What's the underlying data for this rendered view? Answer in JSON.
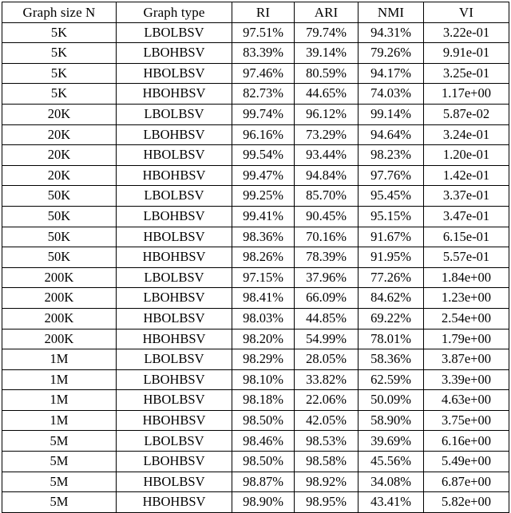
{
  "table": {
    "columns": [
      "Graph size N",
      "Graph type",
      "RI",
      "ARI",
      "NMI",
      "VI"
    ],
    "rows": [
      [
        "5K",
        "LBOLBSV",
        "97.51%",
        "79.74%",
        "94.31%",
        "3.22e-01"
      ],
      [
        "5K",
        "LBOHBSV",
        "83.39%",
        "39.14%",
        "79.26%",
        "9.91e-01"
      ],
      [
        "5K",
        "HBOLBSV",
        "97.46%",
        "80.59%",
        "94.17%",
        "3.25e-01"
      ],
      [
        "5K",
        "HBOHBSV",
        "82.73%",
        "44.65%",
        "74.03%",
        "1.17e+00"
      ],
      [
        "20K",
        "LBOLBSV",
        "99.74%",
        "96.12%",
        "99.14%",
        "5.87e-02"
      ],
      [
        "20K",
        "LBOHBSV",
        "96.16%",
        "73.29%",
        "94.64%",
        "3.24e-01"
      ],
      [
        "20K",
        "HBOLBSV",
        "99.54%",
        "93.44%",
        "98.23%",
        "1.20e-01"
      ],
      [
        "20K",
        "HBOHBSV",
        "99.47%",
        "94.84%",
        "97.76%",
        "1.42e-01"
      ],
      [
        "50K",
        "LBOLBSV",
        "99.25%",
        "85.70%",
        "95.45%",
        "3.37e-01"
      ],
      [
        "50K",
        "LBOHBSV",
        "99.41%",
        "90.45%",
        "95.15%",
        "3.47e-01"
      ],
      [
        "50K",
        "HBOLBSV",
        "98.36%",
        "70.16%",
        "91.67%",
        "6.15e-01"
      ],
      [
        "50K",
        "HBOHBSV",
        "98.26%",
        "78.39%",
        "91.95%",
        "5.57e-01"
      ],
      [
        "200K",
        "LBOLBSV",
        "97.15%",
        "37.96%",
        "77.26%",
        "1.84e+00"
      ],
      [
        "200K",
        "LBOHBSV",
        "98.41%",
        "66.09%",
        "84.62%",
        "1.23e+00"
      ],
      [
        "200K",
        "HBOLBSV",
        "98.03%",
        "44.85%",
        "69.22%",
        "2.54e+00"
      ],
      [
        "200K",
        "HBOHBSV",
        "98.20%",
        "54.99%",
        "78.01%",
        "1.79e+00"
      ],
      [
        "1M",
        "LBOLBSV",
        "98.29%",
        "28.05%",
        "58.36%",
        "3.87e+00"
      ],
      [
        "1M",
        "LBOHBSV",
        "98.10%",
        "33.82%",
        "62.59%",
        "3.39e+00"
      ],
      [
        "1M",
        "HBOLBSV",
        "98.18%",
        "22.06%",
        "50.09%",
        "4.63e+00"
      ],
      [
        "1M",
        "HBOHBSV",
        "98.50%",
        "42.05%",
        "58.90%",
        "3.75e+00"
      ],
      [
        "5M",
        "LBOLBSV",
        "98.46%",
        "98.53%",
        "39.69%",
        "6.16e+00"
      ],
      [
        "5M",
        "LBOHBSV",
        "98.50%",
        "98.58%",
        "45.56%",
        "5.49e+00"
      ],
      [
        "5M",
        "HBOLBSV",
        "98.87%",
        "98.92%",
        "34.08%",
        "6.87e+00"
      ],
      [
        "5M",
        "HBOHBSV",
        "98.90%",
        "98.95%",
        "43.41%",
        "5.82e+00"
      ]
    ]
  },
  "chart_data": {
    "type": "table",
    "title": "",
    "columns": [
      "Graph size N",
      "Graph type",
      "RI",
      "ARI",
      "NMI",
      "VI"
    ],
    "rows": [
      {
        "graph_size_N": "5K",
        "graph_type": "LBOLBSV",
        "RI": 97.51,
        "ARI": 79.74,
        "NMI": 94.31,
        "VI": 0.322
      },
      {
        "graph_size_N": "5K",
        "graph_type": "LBOHBSV",
        "RI": 83.39,
        "ARI": 39.14,
        "NMI": 79.26,
        "VI": 0.991
      },
      {
        "graph_size_N": "5K",
        "graph_type": "HBOLBSV",
        "RI": 97.46,
        "ARI": 80.59,
        "NMI": 94.17,
        "VI": 0.325
      },
      {
        "graph_size_N": "5K",
        "graph_type": "HBOHBSV",
        "RI": 82.73,
        "ARI": 44.65,
        "NMI": 74.03,
        "VI": 1.17
      },
      {
        "graph_size_N": "20K",
        "graph_type": "LBOLBSV",
        "RI": 99.74,
        "ARI": 96.12,
        "NMI": 99.14,
        "VI": 0.0587
      },
      {
        "graph_size_N": "20K",
        "graph_type": "LBOHBSV",
        "RI": 96.16,
        "ARI": 73.29,
        "NMI": 94.64,
        "VI": 0.324
      },
      {
        "graph_size_N": "20K",
        "graph_type": "HBOLBSV",
        "RI": 99.54,
        "ARI": 93.44,
        "NMI": 98.23,
        "VI": 0.12
      },
      {
        "graph_size_N": "20K",
        "graph_type": "HBOHBSV",
        "RI": 99.47,
        "ARI": 94.84,
        "NMI": 97.76,
        "VI": 0.142
      },
      {
        "graph_size_N": "50K",
        "graph_type": "LBOLBSV",
        "RI": 99.25,
        "ARI": 85.7,
        "NMI": 95.45,
        "VI": 0.337
      },
      {
        "graph_size_N": "50K",
        "graph_type": "LBOHBSV",
        "RI": 99.41,
        "ARI": 90.45,
        "NMI": 95.15,
        "VI": 0.347
      },
      {
        "graph_size_N": "50K",
        "graph_type": "HBOLBSV",
        "RI": 98.36,
        "ARI": 70.16,
        "NMI": 91.67,
        "VI": 0.615
      },
      {
        "graph_size_N": "50K",
        "graph_type": "HBOHBSV",
        "RI": 98.26,
        "ARI": 78.39,
        "NMI": 91.95,
        "VI": 0.557
      },
      {
        "graph_size_N": "200K",
        "graph_type": "LBOLBSV",
        "RI": 97.15,
        "ARI": 37.96,
        "NMI": 77.26,
        "VI": 1.84
      },
      {
        "graph_size_N": "200K",
        "graph_type": "LBOHBSV",
        "RI": 98.41,
        "ARI": 66.09,
        "NMI": 84.62,
        "VI": 1.23
      },
      {
        "graph_size_N": "200K",
        "graph_type": "HBOLBSV",
        "RI": 98.03,
        "ARI": 44.85,
        "NMI": 69.22,
        "VI": 2.54
      },
      {
        "graph_size_N": "200K",
        "graph_type": "HBOHBSV",
        "RI": 98.2,
        "ARI": 54.99,
        "NMI": 78.01,
        "VI": 1.79
      },
      {
        "graph_size_N": "1M",
        "graph_type": "LBOLBSV",
        "RI": 98.29,
        "ARI": 28.05,
        "NMI": 58.36,
        "VI": 3.87
      },
      {
        "graph_size_N": "1M",
        "graph_type": "LBOHBSV",
        "RI": 98.1,
        "ARI": 33.82,
        "NMI": 62.59,
        "VI": 3.39
      },
      {
        "graph_size_N": "1M",
        "graph_type": "HBOLBSV",
        "RI": 98.18,
        "ARI": 22.06,
        "NMI": 50.09,
        "VI": 4.63
      },
      {
        "graph_size_N": "1M",
        "graph_type": "HBOHBSV",
        "RI": 98.5,
        "ARI": 42.05,
        "NMI": 58.9,
        "VI": 3.75
      },
      {
        "graph_size_N": "5M",
        "graph_type": "LBOLBSV",
        "RI": 98.46,
        "ARI": 98.53,
        "NMI": 39.69,
        "VI": 6.16
      },
      {
        "graph_size_N": "5M",
        "graph_type": "LBOHBSV",
        "RI": 98.5,
        "ARI": 98.58,
        "NMI": 45.56,
        "VI": 5.49
      },
      {
        "graph_size_N": "5M",
        "graph_type": "HBOLBSV",
        "RI": 98.87,
        "ARI": 98.92,
        "NMI": 34.08,
        "VI": 6.87
      },
      {
        "graph_size_N": "5M",
        "graph_type": "HBOHBSV",
        "RI": 98.9,
        "ARI": 98.95,
        "NMI": 43.41,
        "VI": 5.82
      }
    ]
  }
}
